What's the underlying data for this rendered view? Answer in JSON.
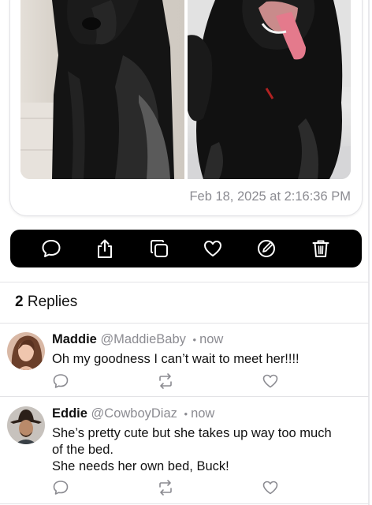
{
  "post": {
    "timestamp": "Feb 18, 2025 at 2:16:36 PM",
    "photos": [
      "dog-photo-1",
      "dog-photo-2"
    ]
  },
  "actions": [
    {
      "icon": "comment-icon"
    },
    {
      "icon": "share-icon"
    },
    {
      "icon": "copy-icon"
    },
    {
      "icon": "heart-icon"
    },
    {
      "icon": "edit-icon"
    },
    {
      "icon": "trash-icon"
    }
  ],
  "replies_header": {
    "count": "2",
    "label": "Replies"
  },
  "replies": [
    {
      "name": "Maddie",
      "handle": "@MaddieBaby",
      "separator": "•",
      "time": "now",
      "body": [
        "Oh my goodness I can’t wait to meet her!!!!"
      ]
    },
    {
      "name": "Eddie",
      "handle": "@CowboyDiaz",
      "separator": "•",
      "time": "now",
      "body": [
        "She’s pretty cute but she takes up way too much",
        "of the bed.",
        "She needs her own bed, Buck!"
      ]
    }
  ],
  "colors": {
    "secondary_text": "#8b8b91",
    "action_bar_bg": "#000000",
    "divider": "#e3e3e6"
  }
}
